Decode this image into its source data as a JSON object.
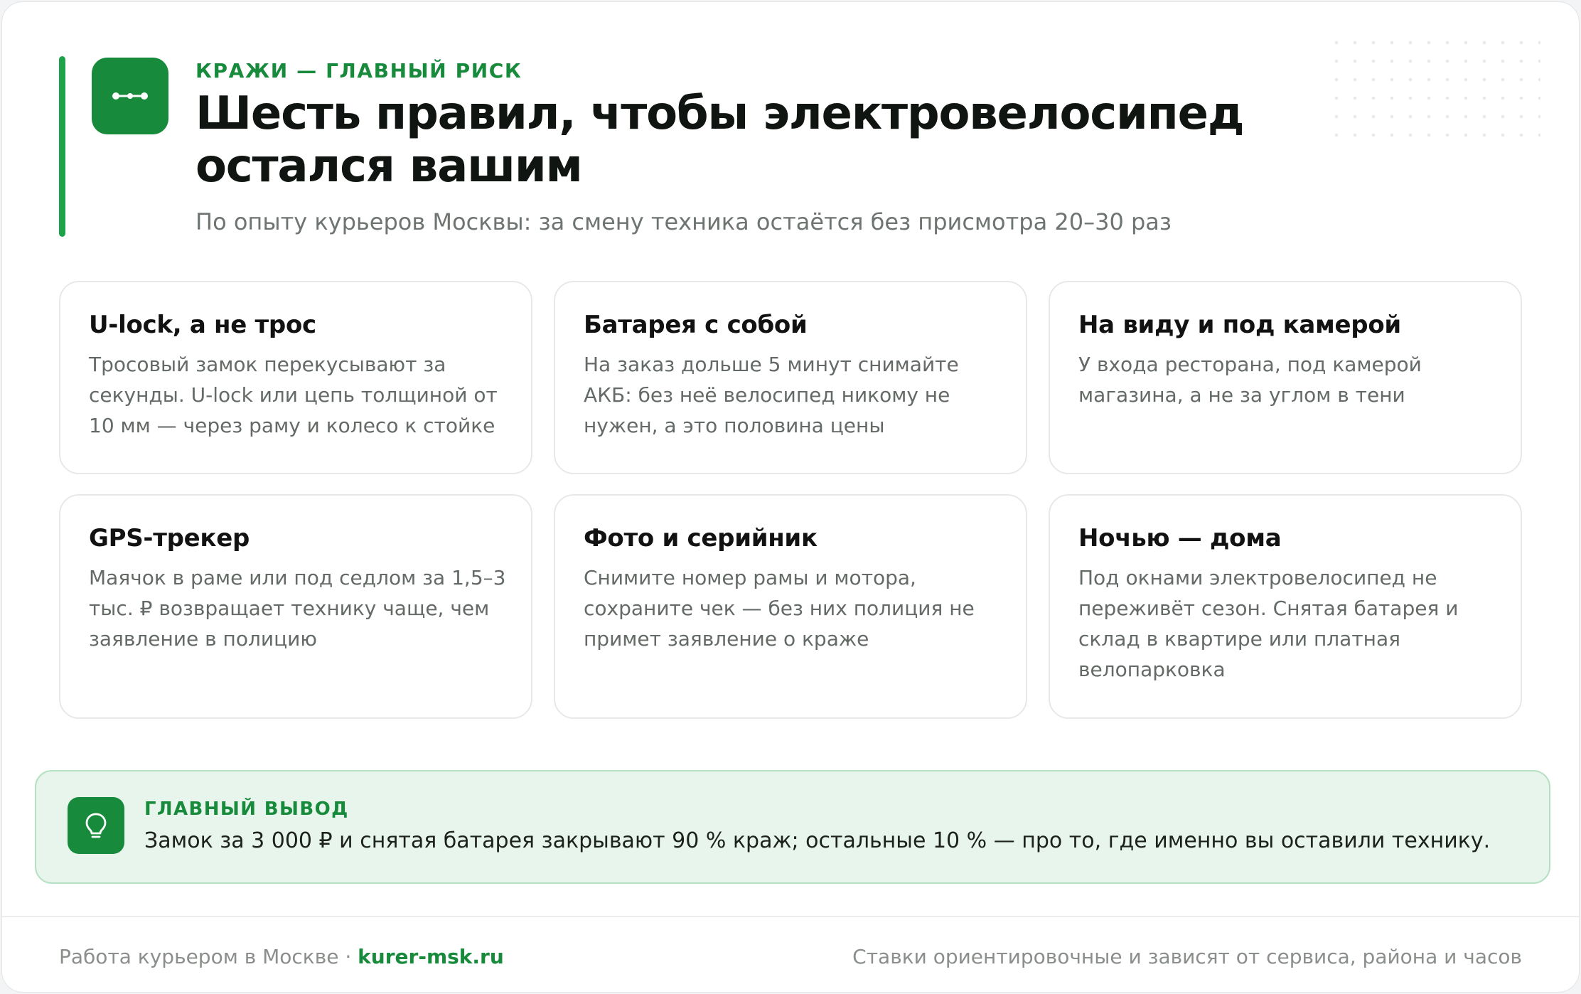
{
  "header": {
    "eyebrow": "КРАЖИ — ГЛАВНЫЙ РИСК",
    "title": "Шесть правил, чтобы электровелосипед остался вашим",
    "subtitle": "По опыту курьеров Москвы: за смену техника остаётся без присмотра 20–30 раз",
    "icon": "chain-link-icon"
  },
  "cards": [
    {
      "title": "U-lock, а не трос",
      "text": "Тросовый замок перекусывают за секунды. U-lock или цепь толщиной от 10 мм — через раму и колесо к стойке"
    },
    {
      "title": "Батарея с собой",
      "text": "На заказ дольше 5 минут снимайте АКБ: без неё велосипед никому не нужен, а это половина цены"
    },
    {
      "title": "На виду и под камерой",
      "text": "У входа ресторана, под камерой магазина, а не за углом в тени"
    },
    {
      "title": "GPS-трекер",
      "text": "Маячок в раме или под седлом за 1,5–3 тыс. ₽ возвращает технику чаще, чем заявление в полицию"
    },
    {
      "title": "Фото и серийник",
      "text": "Снимите номер рамы и мотора, сохраните чек — без них полиция не примет заявление о краже"
    },
    {
      "title": "Ночью — дома",
      "text": "Под окнами электровелосипед не переживёт сезон. Снятая батарея и склад в квартире или платная велопарковка"
    }
  ],
  "conclusion": {
    "label": "ГЛАВНЫЙ ВЫВОД",
    "text": "Замок за 3 000 ₽ и снятая батарея закрывают 90 % краж; остальные 10 % — про то, где именно вы оставили технику.",
    "icon": "lightbulb-icon"
  },
  "footer": {
    "left_text": "Работа курьером в Москве · ",
    "link_text": "kurer-msk.ru",
    "right_text": "Ставки ориентировочные и зависят от сервиса, района и часов"
  },
  "colors": {
    "accent": "#178a3c",
    "accent_bar": "#1fa34a",
    "conclusion_bg": "#e8f5ec",
    "conclusion_border": "#b6e0c2"
  }
}
